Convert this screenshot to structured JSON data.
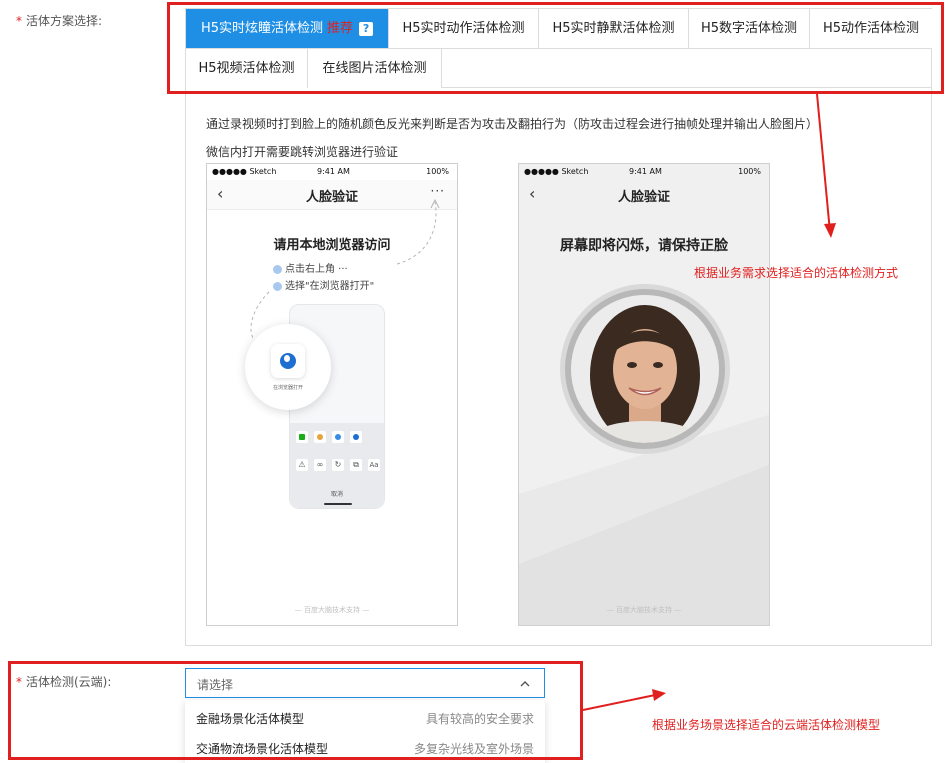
{
  "form": {
    "scheme_label": "活体方案选择:",
    "cloud_label": "活体检测(云端):",
    "required_mark": "*"
  },
  "tabs": [
    {
      "label": "H5实时炫瞳活体检测",
      "badge": "推荐",
      "help": "?",
      "active": true
    },
    {
      "label": "H5实时动作活体检测",
      "active": false
    },
    {
      "label": "H5实时静默活体检测",
      "active": false
    },
    {
      "label": "H5数字活体检测",
      "active": false
    },
    {
      "label": "H5动作活体检测",
      "active": false
    },
    {
      "label": "H5视频活体检测",
      "active": false
    },
    {
      "label": "在线图片活体检测",
      "active": false
    }
  ],
  "panel": {
    "description": "通过录视频时打到脸上的随机颜色反光来判断是否为攻击及翻拍行为（防攻击过程会进行抽帧处理并输出人脸图片）",
    "wechat_note": "微信内打开需要跳转浏览器进行验证"
  },
  "phone_left": {
    "carrier": "●●●●● Sketch",
    "time": "9:41 AM",
    "battery": "100%",
    "title": "人脸验证",
    "more": "···",
    "heading": "请用本地浏览器访问",
    "step1": "点击右上角 ···",
    "step2": "选择\"在浏览器打开\"",
    "open_label": "在浏览器打开",
    "cancel": "取消",
    "footer": "— 百度大脑技术支持 —"
  },
  "phone_right": {
    "carrier": "●●●●● Sketch",
    "time": "9:41 AM",
    "battery": "100%",
    "title": "人脸验证",
    "heading": "屏幕即将闪烁，请保持正脸",
    "footer": "— 百度大脑技术支持 —"
  },
  "select": {
    "placeholder": "请选择",
    "options": [
      {
        "name": "金融场景化活体模型",
        "hint": "具有较高的安全要求"
      },
      {
        "name": "交通物流场景化活体模型",
        "hint": "多复杂光线及室外场景"
      }
    ]
  },
  "annotations": {
    "scheme": "根据业务需求选择适合的活体检测方式",
    "model": "根据业务场景选择适合的云端活体检测模型"
  },
  "colors": {
    "accent": "#1f8fe5",
    "annotation_red": "#e0201f",
    "required_red": "#e02020"
  }
}
